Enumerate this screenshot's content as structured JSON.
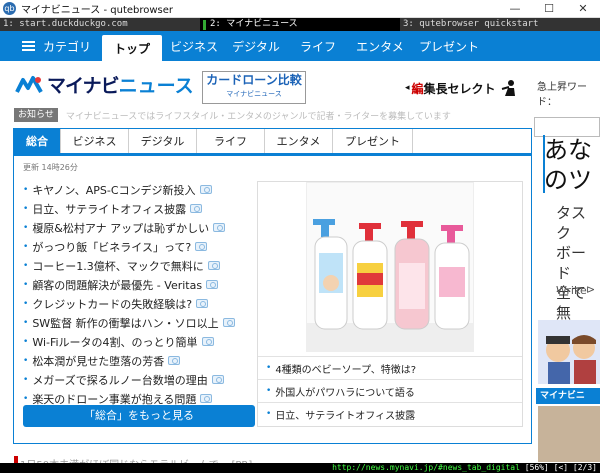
{
  "window": {
    "title": "マイナビニュース - qutebrowser",
    "icon_text": "qb",
    "controls": [
      "—",
      "☐",
      "✕"
    ]
  },
  "tabs": [
    {
      "label": "1: start.duckduckgo.com",
      "active": false
    },
    {
      "label": "2: マイナビニュース",
      "active": true
    },
    {
      "label": "3: qutebrowser quickstart",
      "active": false
    }
  ],
  "nav": {
    "category_label": "カテゴリ",
    "items": [
      "トップ",
      "ビジネス",
      "デジタル",
      "ライフ",
      "エンタメ",
      "プレゼント"
    ],
    "active_index": 0
  },
  "header": {
    "logo_text": "マイナビ",
    "logo_news": "ニュース",
    "loan_title": "カードローン比較",
    "loan_sub": "マイナビニュース",
    "editor_red": "編",
    "editor_rest": "集長セレクト"
  },
  "notice": {
    "label": "お知らせ",
    "text": "マイナビニュースではライフスタイル・エンタメのジャンルで記者・ライターを募集しています"
  },
  "right": {
    "rank_label": "急上昇ワード：",
    "headline_1": "あな",
    "headline_2": "のツ",
    "sub_1": "タスク",
    "sub_2": "ボード",
    "sub_3": "全て無",
    "wrike": "Wrike",
    "arrow": "⊳",
    "blue_label": "マイナビニ"
  },
  "content": {
    "tabs": [
      "総合",
      "ビジネス",
      "デジタル",
      "ライフ",
      "エンタメ",
      "プレゼント"
    ],
    "active_tab": 0,
    "updated": "更新 14時26分",
    "articles": [
      {
        "title": "キヤノン、APS-Cコンデジ新投入",
        "camera": true
      },
      {
        "title": "日立、サテライトオフィス披露",
        "camera": true
      },
      {
        "title": "榎原&松村アナ アップは恥ずかしい",
        "camera": true
      },
      {
        "title": "がっつり飯「ビネライス」って?",
        "camera": true
      },
      {
        "title": "コーヒー1.3億杯、マックで無料に",
        "camera": true
      },
      {
        "title": "顧客の問題解決が最優先 - Veritas",
        "camera": true
      },
      {
        "title": "クレジットカードの失敗経験は?",
        "camera": true
      },
      {
        "title": "SW監督 新作の衝撃はハン・ソロ以上",
        "camera": true
      },
      {
        "title": "Wi-Fiルータの4割、のっとり簡単",
        "camera": true
      },
      {
        "title": "松本潤が見せた堕落の芳香",
        "camera": true
      },
      {
        "title": "メガーズで探るルノー台数増の理由",
        "camera": true
      },
      {
        "title": "楽天のドローン事業が抱える問題",
        "camera": true
      }
    ],
    "more_button": "「総合」をもっと見る",
    "feature_items": [
      "4種類のベビーソープ、特徴は?",
      "外国人がパワハラについて語る",
      "日立、サテライトオフィス披露"
    ]
  },
  "bottom": {
    "peek_text": "1日50本未満がほぼ同じならモラルビームで... [PR]"
  },
  "statusbar": {
    "url": "http://news.mynavi.jp/#news_tab_digital",
    "info": " [56%] [<] [2/3]"
  }
}
